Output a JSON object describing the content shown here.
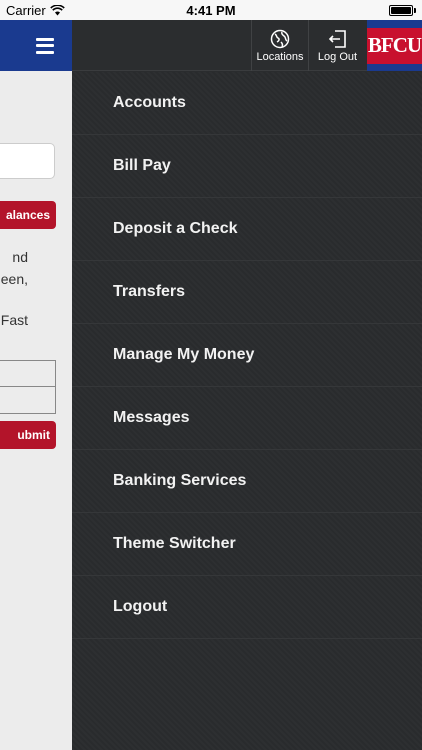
{
  "status_bar": {
    "carrier": "Carrier",
    "time": "4:41 PM",
    "battery_level": 1.0
  },
  "background_page": {
    "balances_button": "alances",
    "text_lines": [
      "nd",
      "een,",
      "Fast"
    ],
    "submit_button": "ubmit"
  },
  "top_bar": {
    "locations_label": "Locations",
    "logout_label": "Log Out",
    "logo_text": "BFCU"
  },
  "menu": {
    "items": [
      {
        "label": "Accounts"
      },
      {
        "label": "Bill Pay"
      },
      {
        "label": "Deposit a Check"
      },
      {
        "label": "Transfers"
      },
      {
        "label": "Manage My Money"
      },
      {
        "label": "Messages"
      },
      {
        "label": "Banking Services"
      },
      {
        "label": "Theme Switcher"
      },
      {
        "label": "Logout"
      }
    ]
  },
  "colors": {
    "brand_blue": "#1a3a8f",
    "brand_red": "#b3142a",
    "menu_bg": "#2a2c2e"
  }
}
